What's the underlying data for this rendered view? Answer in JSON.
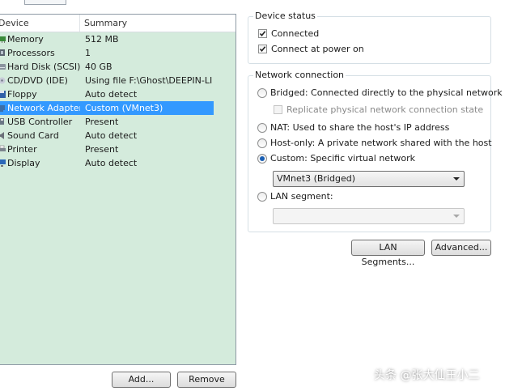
{
  "device_list": {
    "headers": {
      "device": "Device",
      "summary": "Summary"
    },
    "rows": [
      {
        "name": "Memory",
        "summary": "512 MB",
        "icon": "memory-icon",
        "selected": false
      },
      {
        "name": "Processors",
        "summary": "1",
        "icon": "processor-icon",
        "selected": false
      },
      {
        "name": "Hard Disk (SCSI)",
        "summary": "40 GB",
        "icon": "hard-disk-icon",
        "selected": false
      },
      {
        "name": "CD/DVD (IDE)",
        "summary": "Using file F:\\Ghost\\DEEPIN-LI...",
        "icon": "cd-dvd-icon",
        "selected": false
      },
      {
        "name": "Floppy",
        "summary": "Auto detect",
        "icon": "floppy-icon",
        "selected": false
      },
      {
        "name": "Network Adapter",
        "summary": "Custom (VMnet3)",
        "icon": "network-adapter-icon",
        "selected": true
      },
      {
        "name": "USB Controller",
        "summary": "Present",
        "icon": "usb-icon",
        "selected": false
      },
      {
        "name": "Sound Card",
        "summary": "Auto detect",
        "icon": "sound-card-icon",
        "selected": false
      },
      {
        "name": "Printer",
        "summary": "Present",
        "icon": "printer-icon",
        "selected": false
      },
      {
        "name": "Display",
        "summary": "Auto detect",
        "icon": "display-icon",
        "selected": false
      }
    ],
    "add_label": "Add...",
    "remove_label": "Remove"
  },
  "device_status": {
    "title": "Device status",
    "connected_label": "Connected",
    "connected": true,
    "power_on_label": "Connect at power on",
    "power_on": true
  },
  "network_connection": {
    "title": "Network connection",
    "bridged_label": "Bridged: Connected directly to the physical network",
    "replicate_label": "Replicate physical network connection state",
    "nat_label": "NAT: Used to share the host's IP address",
    "host_only_label": "Host-only: A private network shared with the host",
    "custom_label": "Custom: Specific virtual network",
    "custom_value": "VMnet3 (Bridged)",
    "lan_segment_label": "LAN segment:",
    "lan_segment_value": "",
    "selected": "custom"
  },
  "buttons": {
    "lan_segments_label": "LAN Segments...",
    "advanced_label": "Advanced..."
  },
  "colors": {
    "list_background": "#d4ebdc",
    "selection": "#3399ff",
    "radio_dot": "#1a5fb4"
  },
  "watermark": "头条 @张大仙王小二"
}
